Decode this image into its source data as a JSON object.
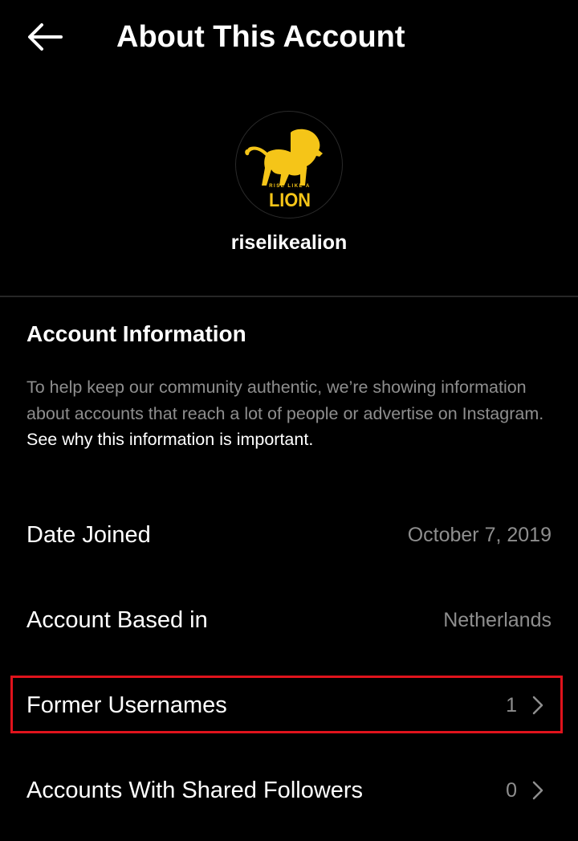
{
  "header": {
    "title": "About This Account",
    "back_icon": "arrow-left-icon"
  },
  "profile": {
    "username": "riselikealion",
    "avatar": {
      "logo_small_text": "RISE LIKE A",
      "logo_big_text": "LION",
      "logo_color": "#f5c518"
    }
  },
  "account_info": {
    "heading": "Account Information",
    "description": "To help keep our community authentic, we’re showing information about accounts that reach a lot of people or advertise on Instagram.",
    "link_text": "See why this information is important."
  },
  "rows": [
    {
      "label": "Date Joined",
      "value": "October 7, 2019"
    },
    {
      "label": "Account Based in",
      "value": "Netherlands"
    },
    {
      "label": "Former Usernames",
      "value": "1",
      "icon": "chevron-right-icon"
    },
    {
      "label": "Accounts With Shared Followers",
      "value": "0",
      "icon": "chevron-right-icon"
    }
  ],
  "colors": {
    "background": "#000000",
    "text_primary": "#ffffff",
    "text_secondary": "#8e8e8e",
    "divider": "#262626",
    "highlight": "#e0131c"
  }
}
